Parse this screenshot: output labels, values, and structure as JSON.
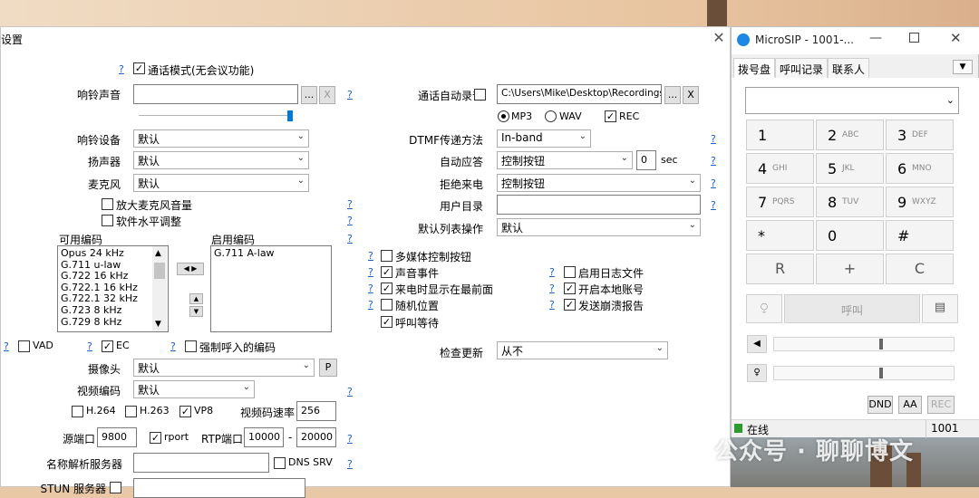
{
  "settings": {
    "title": "设置",
    "help": "?",
    "call_mode": "通话模式(无会议功能)",
    "ringtone_label": "响铃声音",
    "browse": "...",
    "clear": "X",
    "ring_device_label": "响铃设备",
    "ring_device_value": "默认",
    "speaker_label": "扬声器",
    "speaker_value": "默认",
    "mic_label": "麦克风",
    "mic_value": "默认",
    "amplify_mic": "放大麦克风音量",
    "software_level": "软件水平调整",
    "available_codecs_label": "可用编码",
    "available_codecs": [
      "Opus 24 kHz",
      "G.711 u-law",
      "G.722 16 kHz",
      "G.722.1 16 kHz",
      "G.722.1 32 kHz",
      "G.723 8 kHz",
      "G.729 8 kHz"
    ],
    "enabled_codecs_label": "启用编码",
    "enabled_codecs": [
      "G.711 A-law"
    ],
    "vad": "VAD",
    "ec": "EC",
    "force_codec": "强制呼入的编码",
    "camera_label": "摄像头",
    "camera_value": "默认",
    "camera_btn": "P",
    "video_codec_label": "视频编码",
    "video_codec_value": "默认",
    "h264": "H.264",
    "h263": "H.263",
    "vp8": "VP8",
    "video_bitrate_label": "视频码速率",
    "video_bitrate": "256",
    "source_port_label": "源端口",
    "source_port": "9800",
    "rport": "rport",
    "rtp_port_label": "RTP端口",
    "rtp_from": "10000",
    "rtp_dash": "-",
    "rtp_to": "20000",
    "dns_label": "名称解析服务器",
    "dns_srv": "DNS SRV",
    "stun_label": "STUN 服务器",
    "auto_record_label": "通话自动录音",
    "record_path": "C:\\Users\\Mike\\Desktop\\Recordings",
    "mp3": "MP3",
    "wav": "WAV",
    "rec": "REC",
    "dtmf_label": "DTMF传递方法",
    "dtmf_value": "In-band",
    "auto_answer_label": "自动应答",
    "auto_answer_value": "控制按钮",
    "auto_answer_sec": "0",
    "sec": "sec",
    "reject_label": "拒绝来电",
    "reject_value": "控制按钮",
    "user_dir_label": "用户目录",
    "default_list_label": "默认列表操作",
    "default_list_value": "默认",
    "media_buttons": "多媒体控制按钮",
    "sound_events": "声音事件",
    "bring_front": "来电时显示在最前面",
    "random_pos": "随机位置",
    "call_waiting": "呼叫等待",
    "enable_log": "启用日志文件",
    "local_account": "开启本地账号",
    "crash_report": "发送崩溃报告",
    "check_update_label": "检查更新",
    "check_update_value": "从不"
  },
  "microsip": {
    "title": "MicroSIP - 1001-...",
    "tabs": [
      "拨号盘",
      "呼叫记录",
      "联系人"
    ],
    "keys": [
      {
        "d": "1",
        "s": ""
      },
      {
        "d": "2",
        "s": "ABC"
      },
      {
        "d": "3",
        "s": "DEF"
      },
      {
        "d": "4",
        "s": "GHI"
      },
      {
        "d": "5",
        "s": "JKL"
      },
      {
        "d": "6",
        "s": "MNO"
      },
      {
        "d": "7",
        "s": "PQRS"
      },
      {
        "d": "8",
        "s": "TUV"
      },
      {
        "d": "9",
        "s": "WXYZ"
      },
      {
        "d": "*",
        "s": ""
      },
      {
        "d": "0",
        "s": ""
      },
      {
        "d": "#",
        "s": ""
      }
    ],
    "r_key": "R",
    "plus_key": "+",
    "c_key": "C",
    "call_btn": "呼叫",
    "dnd": "DND",
    "aa": "AA",
    "rec": "REC",
    "status": "在线",
    "account": "1001"
  },
  "watermark": "公众号 · 聊聊博文",
  "colors": {
    "link": "#1a5fc8",
    "status_green": "#2e9b2e",
    "microsip_icon": "#1e88e5"
  }
}
